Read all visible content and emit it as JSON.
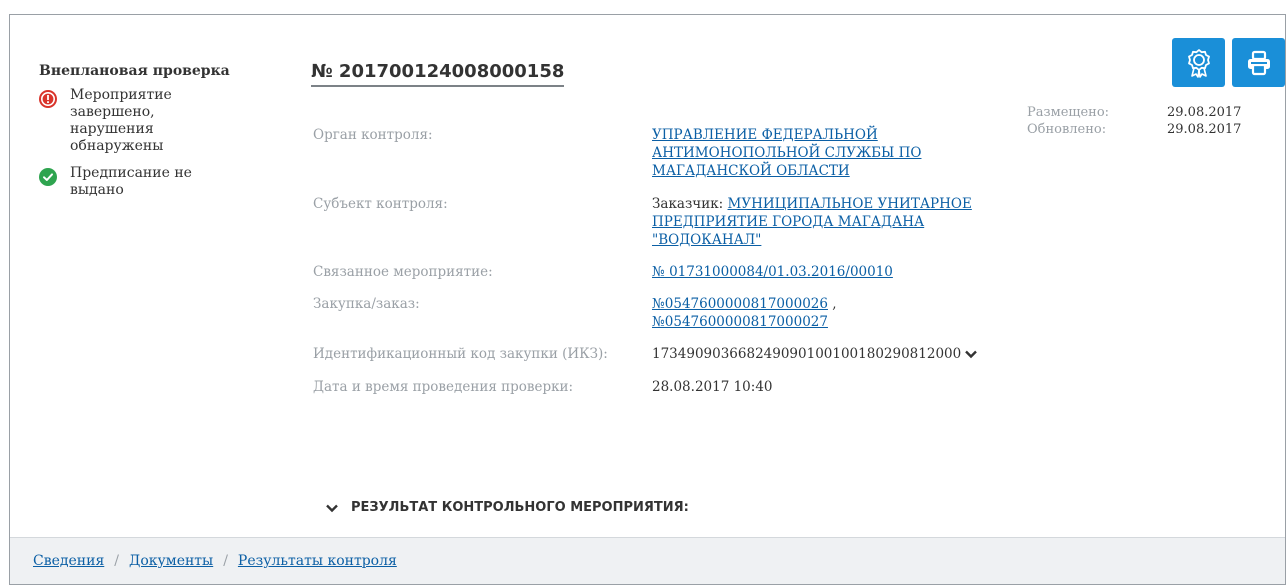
{
  "card": {
    "inspection_type": "Внеплановая проверка",
    "number": "№ 201700124008000158",
    "statuses": [
      {
        "icon": "exclamation-circle-icon",
        "color": "#d9342b",
        "text": "Мероприятие завершено, нарушения обнаружены"
      },
      {
        "icon": "check-circle-icon",
        "color": "#2ea44f",
        "text": "Предписание не выдано"
      }
    ],
    "dates": {
      "posted_label": "Размещено:",
      "posted_value": "29.08.2017",
      "updated_label": "Обновлено:",
      "updated_value": "29.08.2017"
    },
    "fields": {
      "control_body_label": "Орган контроля:",
      "control_body_value": "УПРАВЛЕНИЕ ФЕДЕРАЛЬНОЙ АНТИМОНОПОЛЬНОЙ СЛУЖБЫ ПО МАГАДАНСКОЙ ОБЛАСТИ",
      "subject_label": "Субъект контроля:",
      "subject_prefix": "Заказчик:",
      "subject_value": "МУНИЦИПАЛЬНОЕ УНИТАРНОЕ ПРЕДПРИЯТИЕ ГОРОДА МАГАДАНА \"ВОДОКАНАЛ\"",
      "related_label": "Связанное мероприятие:",
      "related_value": "№ 01731000084/01.03.2016/00010",
      "purchase_label": "Закупка/заказ:",
      "purchase_links": [
        "№0547600000817000026",
        "№0547600000817000027"
      ],
      "ikz_label": "Идентификационный код закупки (ИКЗ):",
      "ikz_value": "173490903668249090100100180290812000",
      "date_label": "Дата и время проведения проверки:",
      "date_value": "28.08.2017 10:40"
    },
    "result_label": "РЕЗУЛЬТАТ КОНТРОЛЬНОГО МЕРОПРИЯТИЯ:"
  },
  "buttons": {
    "award_icon": "award-icon",
    "print_icon": "printer-icon",
    "color": "#1a8fd8"
  },
  "footer": {
    "links": [
      "Сведения",
      "Документы",
      "Результаты контроля"
    ],
    "separator": "/"
  }
}
